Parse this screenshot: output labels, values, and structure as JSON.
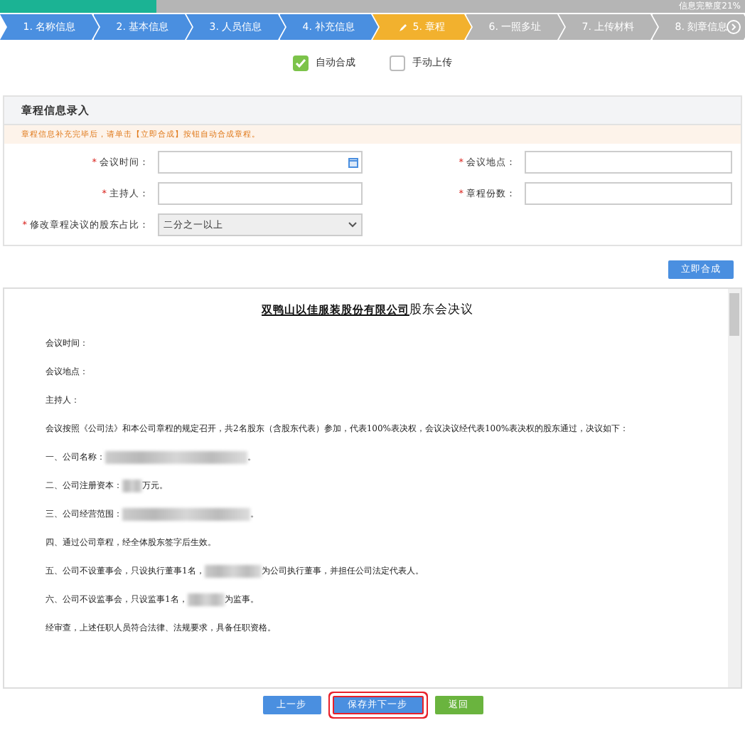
{
  "progress": {
    "level": 0.21,
    "label": "信息完整度21%"
  },
  "steps": [
    {
      "label": "1. 名称信息",
      "done": true,
      "selected": false
    },
    {
      "label": "2. 基本信息",
      "done": true,
      "selected": false
    },
    {
      "label": "3. 人员信息",
      "done": true,
      "selected": false
    },
    {
      "label": "4. 补充信息",
      "done": true,
      "selected": false
    },
    {
      "label": "5. 章程",
      "done": false,
      "selected": true
    },
    {
      "label": "6. 一照多址",
      "done": false,
      "selected": false
    },
    {
      "label": "7. 上传材料",
      "done": false,
      "selected": false
    },
    {
      "label": "8. 刻章信息",
      "done": false,
      "selected": false
    }
  ],
  "modes": [
    {
      "label": "自动合成",
      "checked": true
    },
    {
      "label": "手动上传",
      "checked": false
    }
  ],
  "panel": {
    "title": "章程信息录入",
    "notice": "章程信息补充完毕后，请单击【立即合成】按钮自动合成章程。",
    "fields": [
      {
        "mark": "*",
        "label": "会议时间：",
        "kind": "date"
      },
      {
        "mark": "*",
        "label": "会议地点：",
        "kind": "text"
      },
      {
        "mark": "*",
        "label": "主持人：",
        "kind": "text"
      },
      {
        "mark": "*",
        "label": "章程份数：",
        "kind": "text"
      }
    ],
    "ratio": {
      "mark": "*",
      "label": "修改章程决议的股东占比：",
      "value": "二分之一以上"
    }
  },
  "compose_button": "立即合成",
  "document": {
    "title_company": "双鸭山以佳服装股份有限公司",
    "title_rest": "股东会决议",
    "paragraphs": [
      {
        "before": "会议时间：",
        "redacted": false
      },
      {
        "before": "会议地点：",
        "redacted": false
      },
      {
        "before": "主持人：",
        "redacted": false
      },
      {
        "before": "会议按照《公司法》和本公司章程的规定召开，共2名股东（含股东代表）参加，代表100%表决权，会议决议经代表100%表决权的股东通过，决议如下：",
        "redacted": false
      },
      {
        "before": "一、公司名称：",
        "redacted": true,
        "after": "。"
      },
      {
        "before": "二、公司注册资本：",
        "redacted": true,
        "after": "万元。"
      },
      {
        "before": "三、公司经营范围：",
        "redacted": true,
        "after": "。"
      },
      {
        "before": "四、通过公司章程，经全体股东签字后生效。",
        "redacted": false
      },
      {
        "before": "五、公司不设董事会，只设执行董事1名，",
        "redacted": true,
        "after": "为公司执行董事，并担任公司法定代表人。"
      },
      {
        "before": "六、公司不设监事会，只设监事1名，",
        "redacted": true,
        "after": "为监事。"
      },
      {
        "before": "经审查，上述任职人员符合法律、法规要求，具备任职资格。",
        "redacted": false
      }
    ]
  },
  "buttons": [
    {
      "label": "上一步",
      "kind": "primary",
      "highlighted": false
    },
    {
      "label": "保存并下一步",
      "kind": "primary",
      "highlighted": true
    },
    {
      "label": "返回",
      "kind": "success",
      "highlighted": false
    }
  ]
}
